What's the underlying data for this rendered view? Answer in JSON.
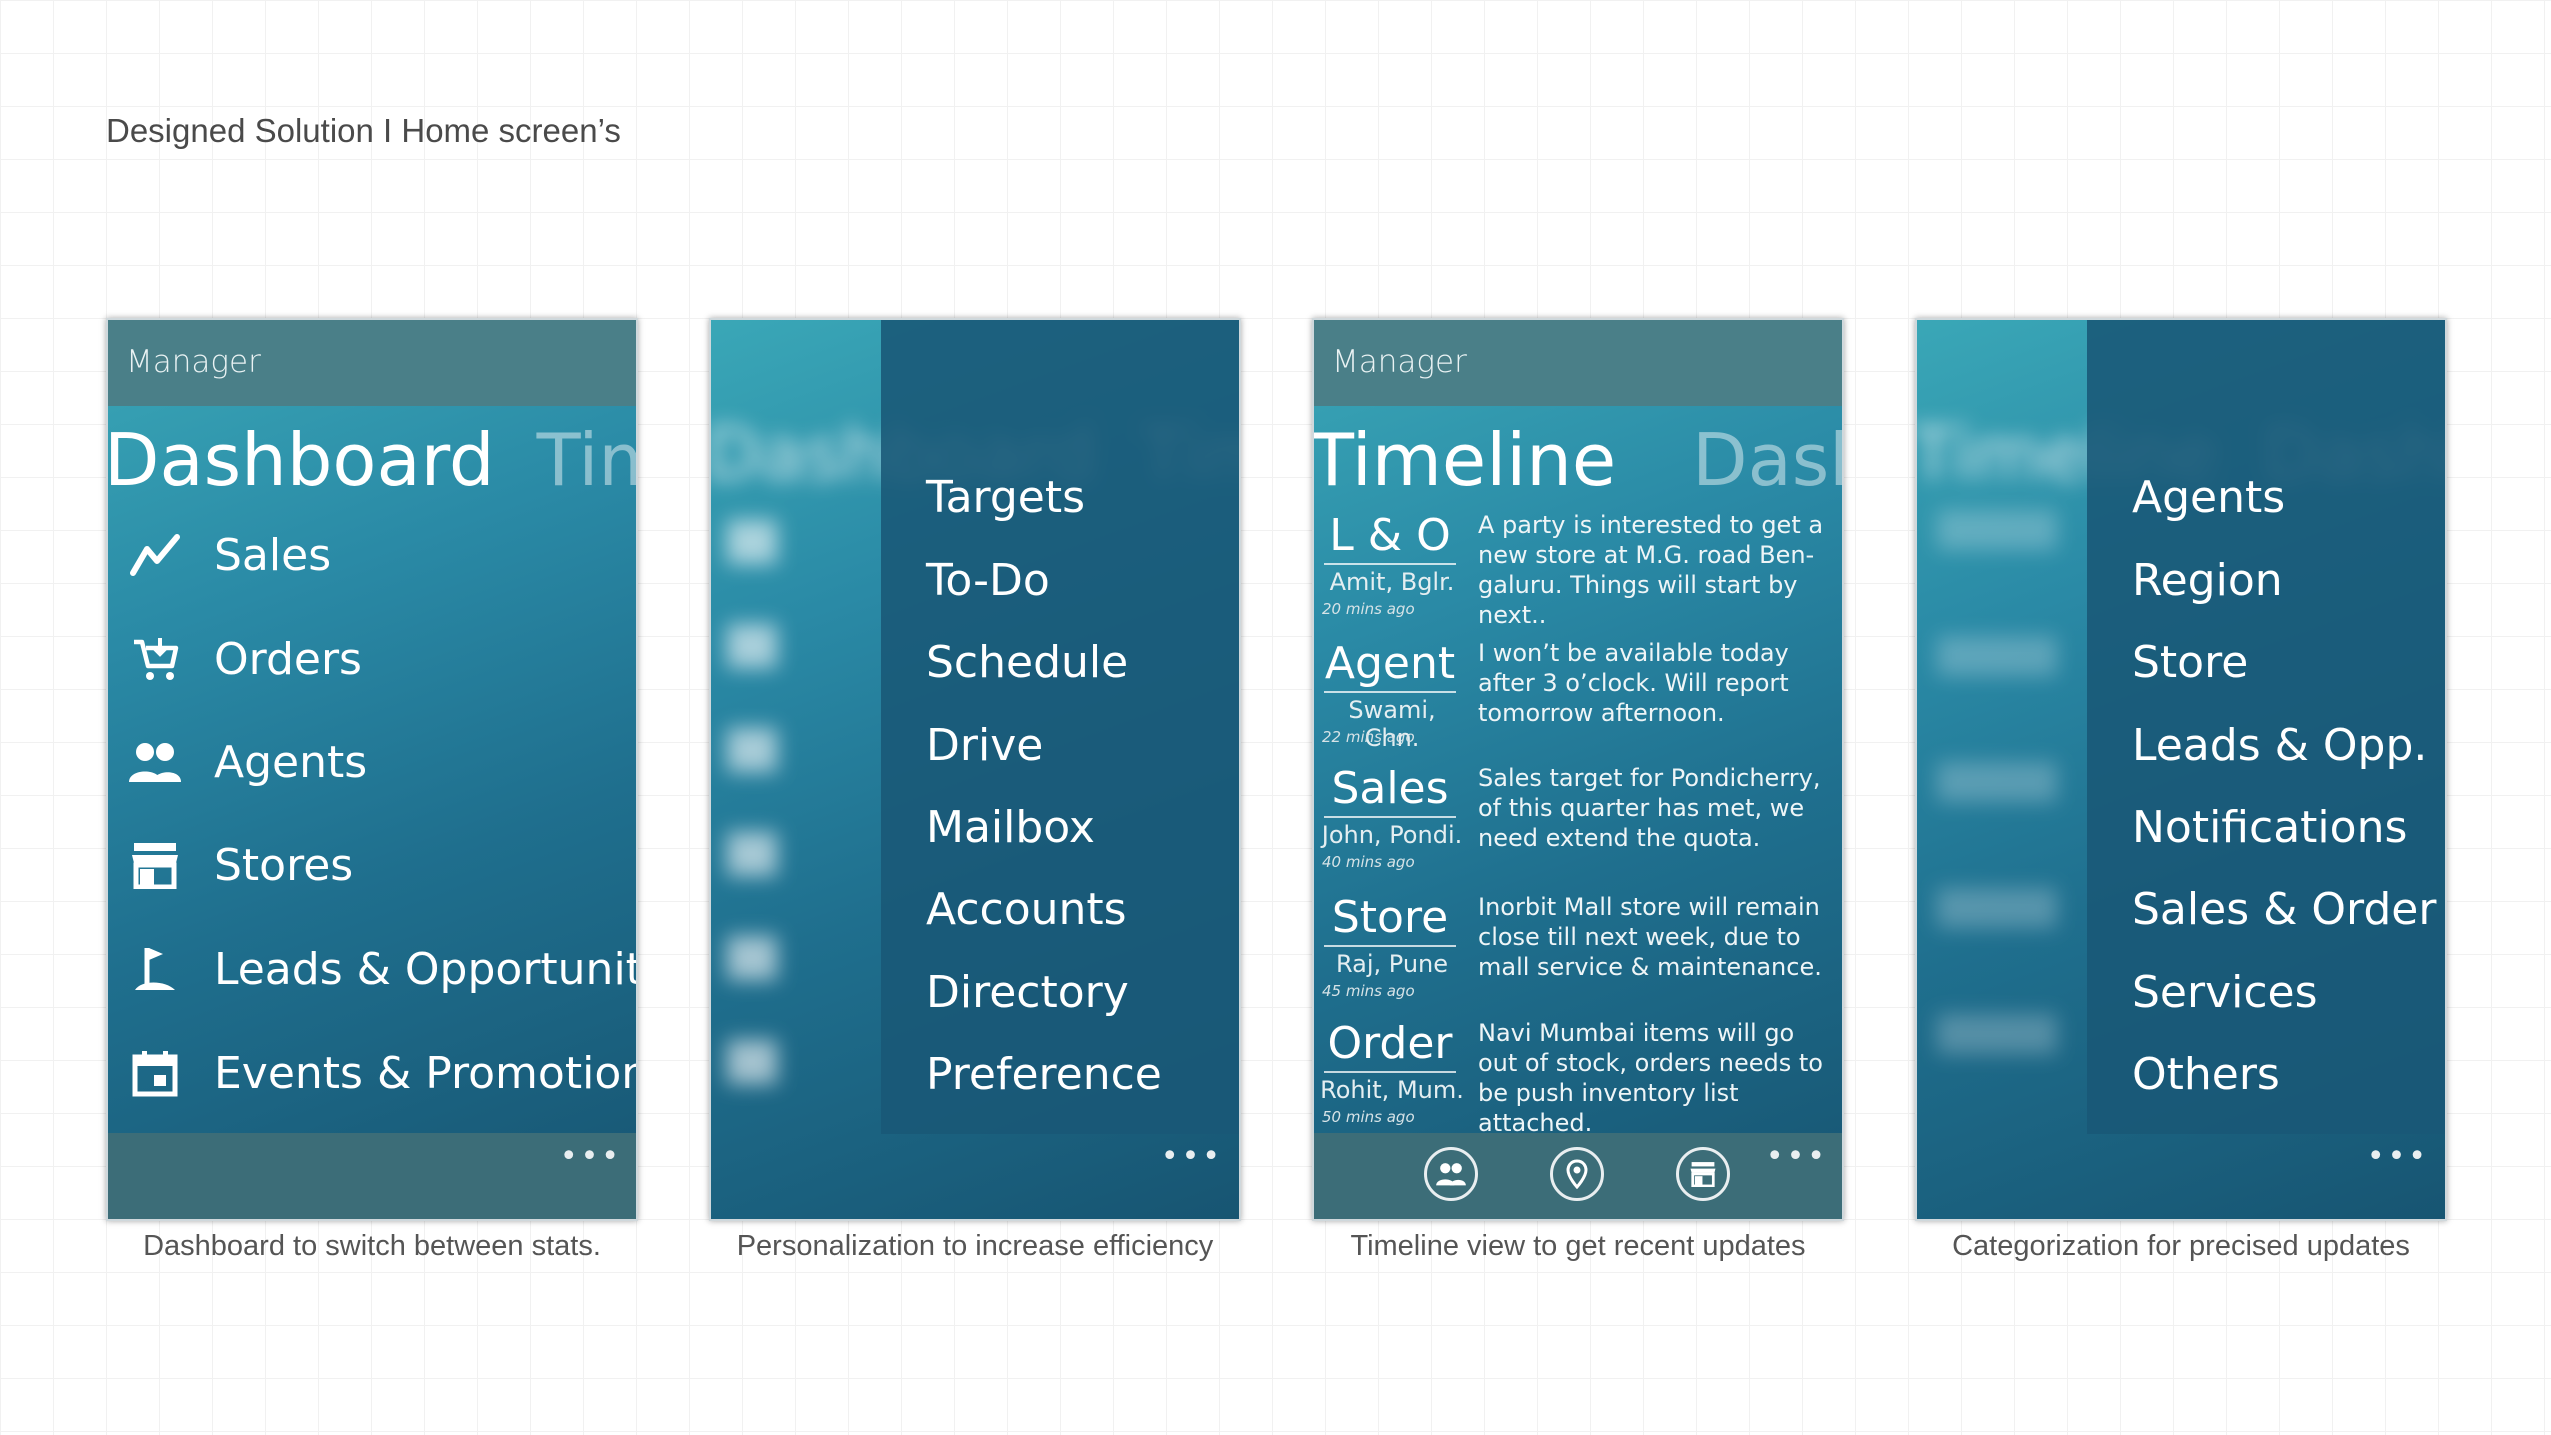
{
  "page_title": "Designed Solution I Home screen’s",
  "screens": [
    {
      "appbar_title": "Manager",
      "pivot_active": "Dashboard",
      "pivot_next": "Time",
      "menu": [
        {
          "label": "Sales",
          "icon": "trend-line-icon"
        },
        {
          "label": "Orders",
          "icon": "cart-icon"
        },
        {
          "label": "Agents",
          "icon": "people-icon"
        },
        {
          "label": "Stores",
          "icon": "store-icon"
        },
        {
          "label": "Leads & Opportunities",
          "icon": "flag-icon"
        },
        {
          "label": "Events & Promotions",
          "icon": "calendar-icon"
        }
      ],
      "more": "•••",
      "caption": "Dashboard to switch between stats."
    },
    {
      "panel_items": [
        "Targets",
        "To-Do",
        "Schedule",
        "Drive",
        "Mailbox",
        "Accounts",
        "Directory",
        "Preference"
      ],
      "more": "•••",
      "caption": "Personalization to increase efficiency"
    },
    {
      "appbar_title": "Manager",
      "pivot_active": "Timeline",
      "pivot_next": "Dashb",
      "entries": [
        {
          "category": "L & O",
          "who": "Amit, Bglr.",
          "time": "20 mins ago",
          "message": "A party is interested to get a new store at M.G. road Ben-galuru. Things will start by next.."
        },
        {
          "category": "Agent",
          "who": "Swami, Chn.",
          "time": "22 mins ago",
          "message": "I won’t be available today after 3 o’clock. Will report tomorrow afternoon."
        },
        {
          "category": "Sales",
          "who": "John, Pondi.",
          "time": "40 mins ago",
          "message": "Sales target for Pondicherry, of this quarter has met, we need extend the quota."
        },
        {
          "category": "Store",
          "who": "Raj, Pune",
          "time": "45 mins ago",
          "message": "Inorbit Mall store will remain close till next week, due to mall service & maintenance."
        },
        {
          "category": "Order",
          "who": "Rohit, Mum.",
          "time": "50 mins ago",
          "message": "Navi Mumbai items will go out of stock, orders needs to be push inventory list attached."
        }
      ],
      "bottom_icons": [
        "people-icon",
        "location-pin-icon",
        "store-icon"
      ],
      "more": "•••",
      "caption": "Timeline view to get recent updates"
    },
    {
      "panel_items": [
        "Agents",
        "Region",
        "Store",
        "Leads & Opp.",
        "Notifications",
        "Sales & Order",
        "Services",
        "Others"
      ],
      "more": "•••",
      "caption": "Categorization for precised updates"
    }
  ]
}
